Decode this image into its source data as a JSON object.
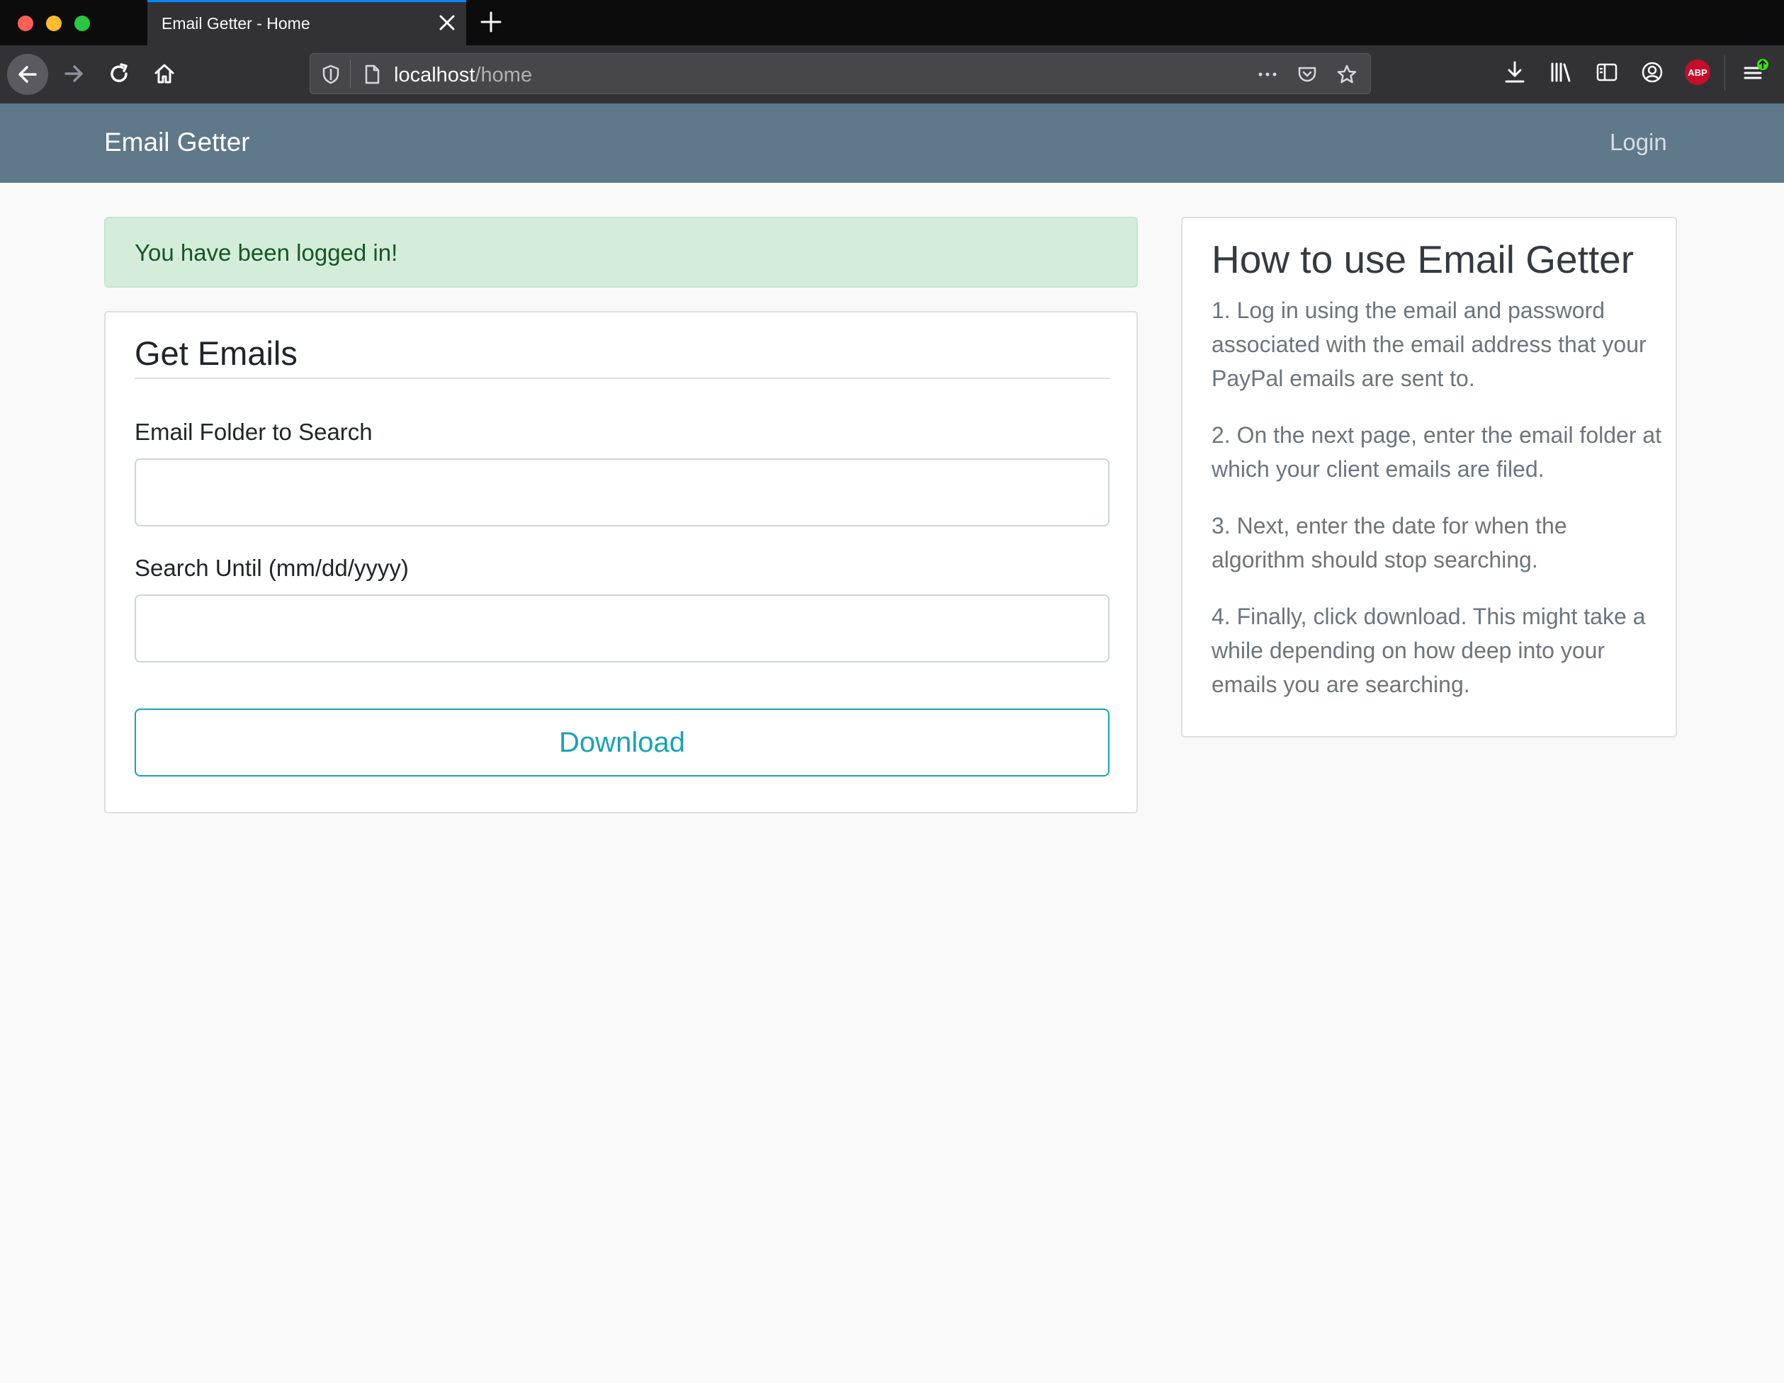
{
  "browser": {
    "tab_title": "Email Getter - Home",
    "url_host": "localhost",
    "url_path": "/home",
    "extension_badge": "ABP"
  },
  "site": {
    "brand": "Email Getter",
    "login_label": "Login"
  },
  "alert": {
    "message": "You have been logged in!"
  },
  "form": {
    "title": "Get Emails",
    "folder_label": "Email Folder to Search",
    "folder_value": "",
    "date_label": "Search Until (mm/dd/yyyy)",
    "date_value": "",
    "download_label": "Download"
  },
  "help": {
    "title": "How to use Email Getter",
    "steps": [
      "1. Log in using the email and password associated with the email address that your PayPal emails are sent to.",
      "2. On the next page, enter the email folder at which your client emails are filed.",
      "3. Next, enter the date for when the algorithm should stop searching.",
      "4. Finally, click download. This might take a while depending on how deep into your emails you are searching."
    ]
  },
  "colors": {
    "navbar": "#5f788a",
    "alert_bg": "#d4edda",
    "alert_text": "#155724",
    "download_accent": "#17a2b8"
  }
}
